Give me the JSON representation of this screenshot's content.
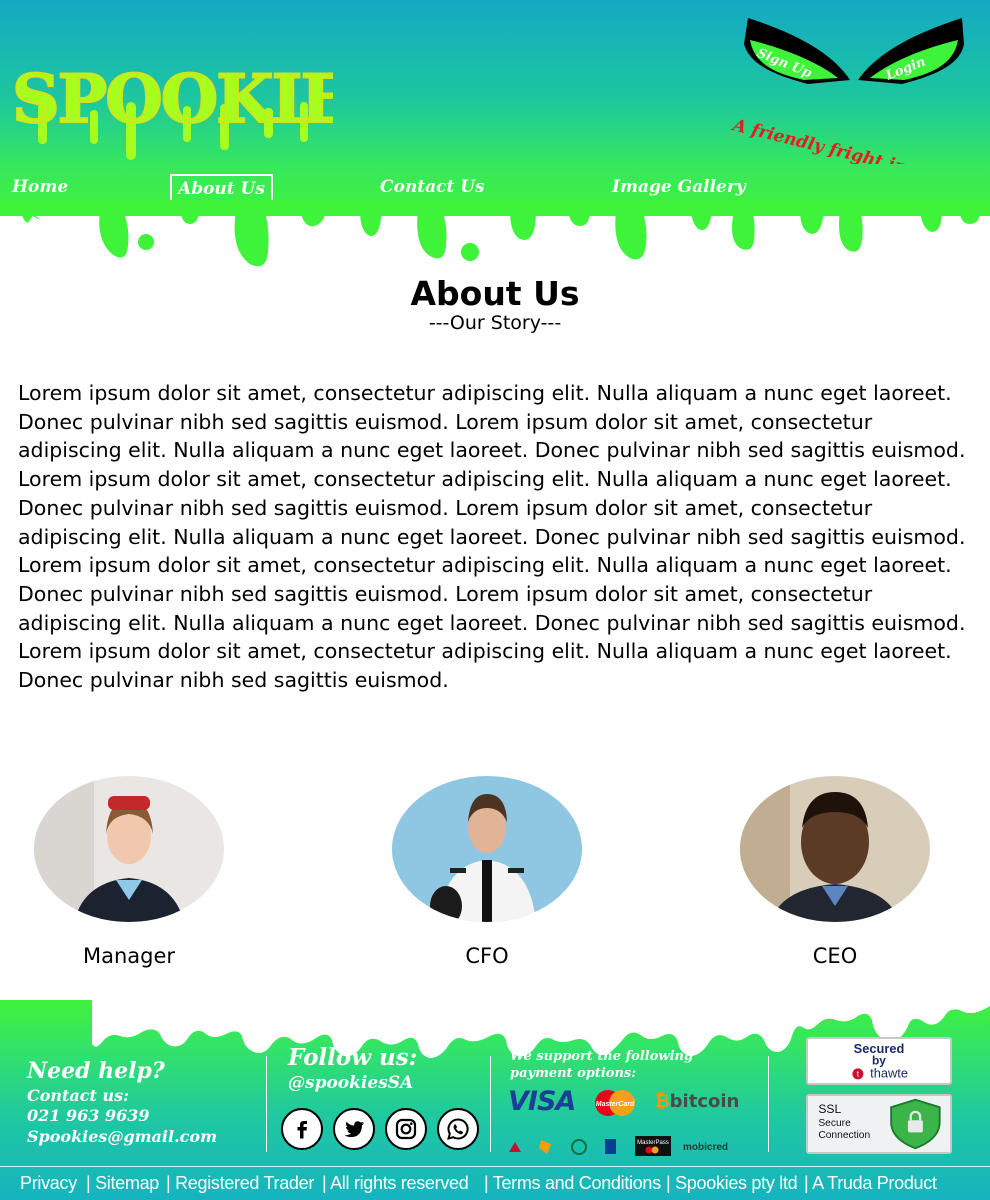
{
  "brand": {
    "logo_text": "SPOOKIES",
    "tagline": "A friendly fright in every bite"
  },
  "auth": {
    "signup_label": "Sign Up",
    "login_label": "Login"
  },
  "nav": {
    "items": [
      {
        "label": "Home",
        "active": false
      },
      {
        "label": "About Us",
        "active": true
      },
      {
        "label": "Contact Us",
        "active": false
      },
      {
        "label": "Image Gallery",
        "active": false
      }
    ]
  },
  "main": {
    "title": "About Us",
    "subtitle": "---Our Story---",
    "story": "Lorem ipsum dolor sit amet, consectetur adipiscing elit. Nulla aliquam a nunc eget laoreet. Donec pulvinar nibh sed sagittis euismod. Lorem ipsum dolor sit amet, consectetur adipiscing elit. Nulla aliquam a nunc eget laoreet. Donec pulvinar nibh sed sagittis euismod. Lorem ipsum dolor sit amet, consectetur adipiscing elit. Nulla aliquam a nunc eget laoreet. Donec pulvinar nibh sed sagittis euismod. Lorem ipsum dolor sit amet, consectetur adipiscing elit. Nulla aliquam a nunc eget laoreet. Donec pulvinar nibh sed sagittis euismod. Lorem ipsum dolor sit amet, consectetur adipiscing elit. Nulla aliquam a nunc eget laoreet. Donec pulvinar nibh sed sagittis euismod. Lorem ipsum dolor sit amet, consectetur adipiscing elit. Nulla aliquam a nunc eget laoreet. Donec pulvinar nibh sed sagittis euismod. Lorem ipsum dolor sit amet, consectetur adipiscing elit. Nulla aliquam a nunc eget laoreet. Donec pulvinar nibh sed sagittis euismod.",
    "team": [
      {
        "role": "Manager"
      },
      {
        "role": "CFO"
      },
      {
        "role": "CEO"
      }
    ]
  },
  "footer": {
    "help": {
      "title": "Need help?",
      "contact_label": "Contact us:",
      "phone": "021 963 9639",
      "email": "Spookies@gmail.com"
    },
    "follow": {
      "title": "Follow us:",
      "handle": "@spookiesSA",
      "icons": [
        "facebook-icon",
        "twitter-icon",
        "instagram-icon",
        "whatsapp-icon"
      ]
    },
    "payments": {
      "title": "We support the following payment options:",
      "visa": "VISA",
      "mastercard": "MasterCard",
      "bitcoin": "bitcoin",
      "masterpass": "MasterPass",
      "mobicred": "mobicred"
    },
    "security": {
      "thawte_line1": "Secured",
      "thawte_line2": "by",
      "thawte_brand": "thawte",
      "ssl_line1": "SSL",
      "ssl_line2": "Secure",
      "ssl_line3": "Connection"
    },
    "legal": [
      "Privacy",
      "| Sitemap",
      "| Registered Trader",
      "| All rights reserved",
      "| Terms and Conditions",
      "| Spookies pty ltd",
      "| A Truda Product"
    ]
  },
  "colors": {
    "slime_green": "#3ff23a",
    "header_blue": "#15a9c4",
    "tagline_red": "#e0201f"
  }
}
